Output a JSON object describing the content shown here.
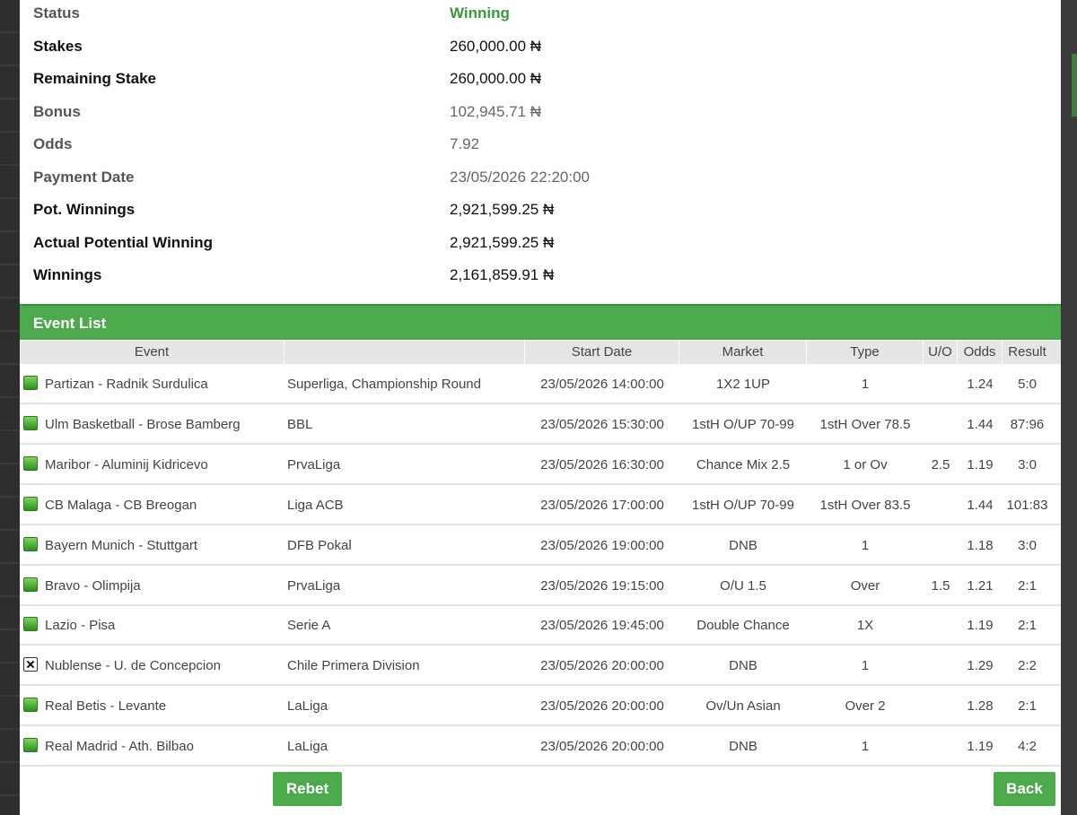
{
  "summary": [
    {
      "label": "Status",
      "value": "Winning",
      "style": "muted",
      "status": true
    },
    {
      "label": "Stakes",
      "value": "260,000.00 ₦",
      "style": "bold"
    },
    {
      "label": "Remaining Stake",
      "value": "260,000.00 ₦",
      "style": "bold"
    },
    {
      "label": "Bonus",
      "value": "102,945.71 ₦",
      "style": "muted"
    },
    {
      "label": "Odds",
      "value": "7.92",
      "style": "muted"
    },
    {
      "label": "Payment Date",
      "value": "23/05/2026 22:20:00",
      "style": "muted"
    },
    {
      "label": "Pot. Winnings",
      "value": "2,921,599.25 ₦",
      "style": "bold"
    },
    {
      "label": "Actual Potential Winning",
      "value": "2,921,599.25 ₦",
      "style": "bold"
    },
    {
      "label": "Winnings",
      "value": "2,161,859.91 ₦",
      "style": "bold"
    }
  ],
  "event_list": {
    "title": "Event List",
    "columns": {
      "event": "Event",
      "league": "",
      "start_date": "Start Date",
      "market": "Market",
      "type": "Type",
      "uo": "U/O",
      "odds": "Odds",
      "result": "Result"
    },
    "rows": [
      {
        "status": "won",
        "event": "Partizan - Radnik Surdulica",
        "league": "Superliga, Championship Round",
        "start_date": "23/05/2026 14:00:00",
        "market": "1X2 1UP",
        "type": "1",
        "uo": "",
        "odds": "1.24",
        "result": "5:0"
      },
      {
        "status": "won",
        "event": "Ulm Basketball - Brose Bamberg",
        "league": "BBL",
        "start_date": "23/05/2026 15:30:00",
        "market": "1stH O/UP 70-99",
        "type": "1stH Over 78.5",
        "uo": "",
        "odds": "1.44",
        "result": "87:96"
      },
      {
        "status": "won",
        "event": "Maribor - Aluminij Kidricevo",
        "league": "PrvaLiga",
        "start_date": "23/05/2026 16:30:00",
        "market": "Chance Mix 2.5",
        "type": "1 or Ov",
        "uo": "2.5",
        "odds": "1.19",
        "result": "3:0"
      },
      {
        "status": "won",
        "event": "CB Malaga - CB Breogan",
        "league": "Liga ACB",
        "start_date": "23/05/2026 17:00:00",
        "market": "1stH O/UP 70-99",
        "type": "1stH Over 83.5",
        "uo": "",
        "odds": "1.44",
        "result": "101:83"
      },
      {
        "status": "won",
        "event": "Bayern Munich - Stuttgart",
        "league": "DFB Pokal",
        "start_date": "23/05/2026 19:00:00",
        "market": "DNB",
        "type": "1",
        "uo": "",
        "odds": "1.18",
        "result": "3:0"
      },
      {
        "status": "won",
        "event": "Bravo - Olimpija",
        "league": "PrvaLiga",
        "start_date": "23/05/2026 19:15:00",
        "market": "O/U 1.5",
        "type": "Over",
        "uo": "1.5",
        "odds": "1.21",
        "result": "2:1"
      },
      {
        "status": "won",
        "event": "Lazio - Pisa",
        "league": "Serie A",
        "start_date": "23/05/2026 19:45:00",
        "market": "Double Chance",
        "type": "1X",
        "uo": "",
        "odds": "1.19",
        "result": "2:1"
      },
      {
        "status": "lost",
        "event": "Nublense - U. de Concepcion",
        "league": "Chile Primera Division",
        "start_date": "23/05/2026 20:00:00",
        "market": "DNB",
        "type": "1",
        "uo": "",
        "odds": "1.29",
        "result": "2:2"
      },
      {
        "status": "won",
        "event": "Real Betis - Levante",
        "league": "LaLiga",
        "start_date": "23/05/2026 20:00:00",
        "market": "Ov/Un Asian",
        "type": "Over 2",
        "uo": "",
        "odds": "1.28",
        "result": "2:1"
      },
      {
        "status": "won",
        "event": "Real Madrid - Ath. Bilbao",
        "league": "LaLiga",
        "start_date": "23/05/2026 20:00:00",
        "market": "DNB",
        "type": "1",
        "uo": "",
        "odds": "1.19",
        "result": "4:2"
      }
    ]
  },
  "buttons": {
    "rebet": "Rebet",
    "back": "Back"
  },
  "colors": {
    "accent": "#4caa4c",
    "status_winning": "#3a9a3a"
  }
}
